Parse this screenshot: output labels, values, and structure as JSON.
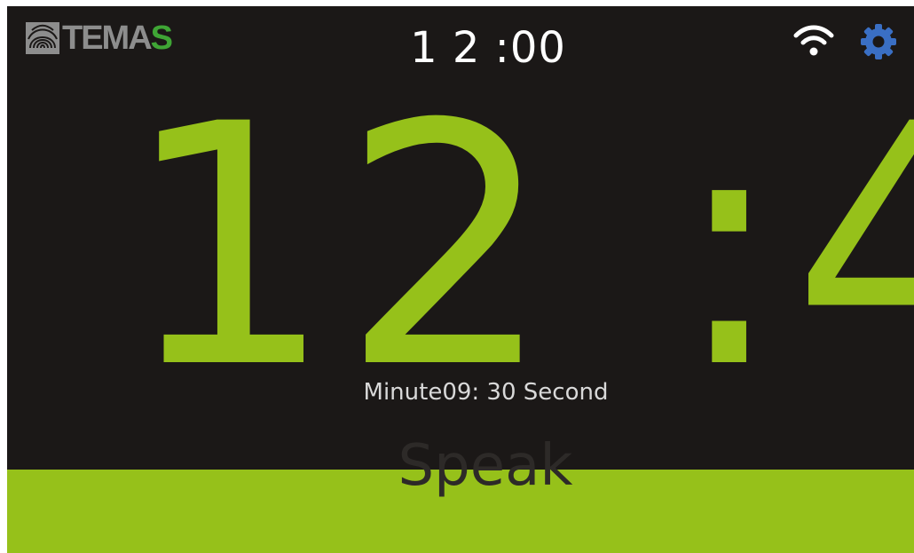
{
  "header": {
    "logo_text_main": "TEMA",
    "logo_text_accent": "S",
    "time": "1 2 :00",
    "wifi_icon": "wifi-icon",
    "settings_icon": "gear-icon"
  },
  "clock": {
    "display": "12 :4"
  },
  "timer": {
    "text": "Minute09: 30 Second"
  },
  "action": {
    "speak_label": "Speak"
  },
  "colors": {
    "background": "#1b1817",
    "accent_green": "#96c11a",
    "gear_blue": "#3a6fc4",
    "logo_green": "#3fa535",
    "logo_gray": "#8d8d8d"
  }
}
